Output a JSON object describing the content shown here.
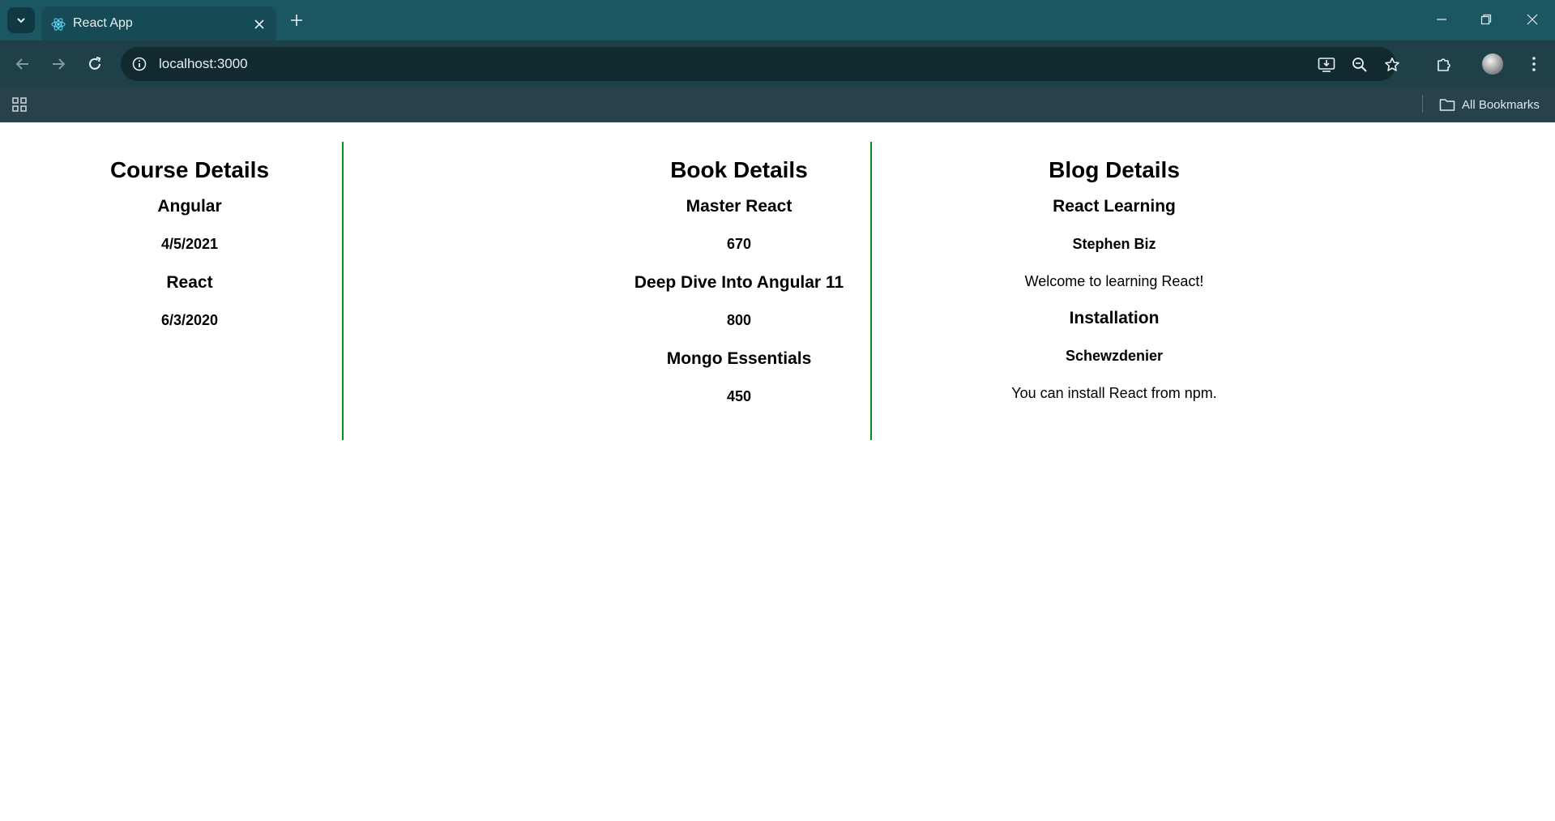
{
  "browser": {
    "tab_title": "React App",
    "url": "localhost:3000",
    "bookmarks_label": "All Bookmarks"
  },
  "course": {
    "heading": "Course Details",
    "items": [
      {
        "name": "Angular",
        "date": "4/5/2021"
      },
      {
        "name": "React",
        "date": "6/3/2020"
      }
    ]
  },
  "book": {
    "heading": "Book Details",
    "items": [
      {
        "name": "Master React",
        "price": "670"
      },
      {
        "name": "Deep Dive Into Angular 11",
        "price": "800"
      },
      {
        "name": "Mongo Essentials",
        "price": "450"
      }
    ]
  },
  "blog": {
    "heading": "Blog Details",
    "items": [
      {
        "title": "React Learning",
        "author": "Stephen Biz",
        "content": "Welcome to learning React!"
      },
      {
        "title": "Installation",
        "author": "Schewzdenier",
        "content": "You can install React from npm."
      }
    ]
  },
  "colors": {
    "tabstrip": "#1b5663",
    "toolbar": "#1f4048",
    "divider": "#0a8a1e"
  }
}
